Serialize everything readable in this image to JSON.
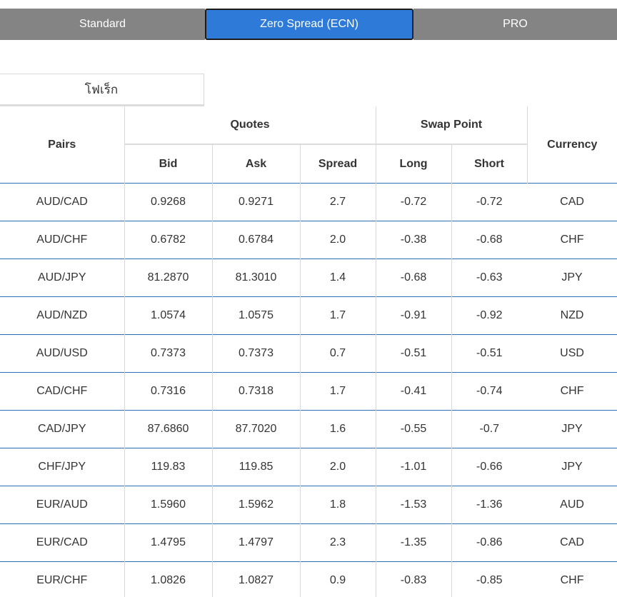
{
  "account_tabs": [
    {
      "label": "Standard",
      "active": false
    },
    {
      "label": "Zero Spread (ECN)",
      "active": true
    },
    {
      "label": "PRO",
      "active": false
    }
  ],
  "category_tab": {
    "label": "โฟเร็ก"
  },
  "table": {
    "headers": {
      "pairs": "Pairs",
      "quotes": "Quotes",
      "swap_point": "Swap Point",
      "currency": "Currency",
      "bid": "Bid",
      "ask": "Ask",
      "spread": "Spread",
      "long": "Long",
      "short": "Short"
    },
    "rows": [
      {
        "pair": "AUD/CAD",
        "bid": "0.9268",
        "ask": "0.9271",
        "spread": "2.7",
        "long": "-0.72",
        "short": "-0.72",
        "currency": "CAD"
      },
      {
        "pair": "AUD/CHF",
        "bid": "0.6782",
        "ask": "0.6784",
        "spread": "2.0",
        "long": "-0.38",
        "short": "-0.68",
        "currency": "CHF"
      },
      {
        "pair": "AUD/JPY",
        "bid": "81.2870",
        "ask": "81.3010",
        "spread": "1.4",
        "long": "-0.68",
        "short": "-0.63",
        "currency": "JPY"
      },
      {
        "pair": "AUD/NZD",
        "bid": "1.0574",
        "ask": "1.0575",
        "spread": "1.7",
        "long": "-0.91",
        "short": "-0.92",
        "currency": "NZD"
      },
      {
        "pair": "AUD/USD",
        "bid": "0.7373",
        "ask": "0.7373",
        "spread": "0.7",
        "long": "-0.51",
        "short": "-0.51",
        "currency": "USD"
      },
      {
        "pair": "CAD/CHF",
        "bid": "0.7316",
        "ask": "0.7318",
        "spread": "1.7",
        "long": "-0.41",
        "short": "-0.74",
        "currency": "CHF"
      },
      {
        "pair": "CAD/JPY",
        "bid": "87.6860",
        "ask": "87.7020",
        "spread": "1.6",
        "long": "-0.55",
        "short": "-0.7",
        "currency": "JPY"
      },
      {
        "pair": "CHF/JPY",
        "bid": "119.83",
        "ask": "119.85",
        "spread": "2.0",
        "long": "-1.01",
        "short": "-0.66",
        "currency": "JPY"
      },
      {
        "pair": "EUR/AUD",
        "bid": "1.5960",
        "ask": "1.5962",
        "spread": "1.8",
        "long": "-1.53",
        "short": "-1.36",
        "currency": "AUD"
      },
      {
        "pair": "EUR/CAD",
        "bid": "1.4795",
        "ask": "1.4797",
        "spread": "2.3",
        "long": "-1.35",
        "short": "-0.86",
        "currency": "CAD"
      },
      {
        "pair": "EUR/CHF",
        "bid": "1.0826",
        "ask": "1.0827",
        "spread": "0.9",
        "long": "-0.83",
        "short": "-0.85",
        "currency": "CHF"
      }
    ]
  },
  "colors": {
    "tab_inactive": "#848484",
    "tab_active": "#2d7ad9",
    "row_divider": "#2d6fb8"
  }
}
